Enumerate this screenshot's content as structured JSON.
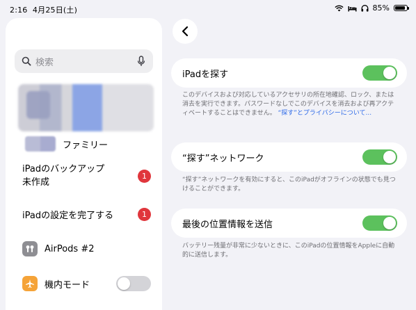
{
  "status_bar": {
    "time": "2:16",
    "date": "4月25日(土)",
    "battery_percent": "85%",
    "battery_level": 0.85
  },
  "sidebar": {
    "search": {
      "placeholder": "検索"
    },
    "family_label": "ファミリー",
    "items": [
      {
        "label_line1": "iPadのバックアップ",
        "label_line2": "未作成",
        "badge": "1"
      },
      {
        "label": "iPadの設定を完了する",
        "badge": "1"
      },
      {
        "label": "AirPods #2",
        "icon": "airpods-icon"
      },
      {
        "label": "機内モード",
        "icon": "airplane-icon",
        "toggle": "off"
      }
    ]
  },
  "detail": {
    "find_my_ipad": {
      "label": "iPadを探す",
      "toggle": "on",
      "description": "このデバイスおよび対応しているアクセサリの所在地確認、ロック、または消去を実行できます。パスワードなしでこのデバイスを消去および再アクティベートすることはできません。",
      "link": "“探す”とプライバシーについて..."
    },
    "find_my_network": {
      "label": "“探す”ネットワーク",
      "toggle": "on",
      "description": "“探す”ネットワークを有効にすると、このiPadがオフラインの状態でも見つけることができます。"
    },
    "send_last_location": {
      "label": "最後の位置情報を送信",
      "toggle": "on",
      "description": "バッテリー残量が非常に少ないときに、このiPadの位置情報をAppleに自動的に送信します。"
    }
  },
  "colors": {
    "toggle_on": "#5cc15d",
    "toggle_off": "#d4d4d8",
    "badge": "#e0363c",
    "link": "#2b68e8",
    "airplane_icon_bg": "#f5a338",
    "airpods_icon_bg": "#8e8e93"
  }
}
